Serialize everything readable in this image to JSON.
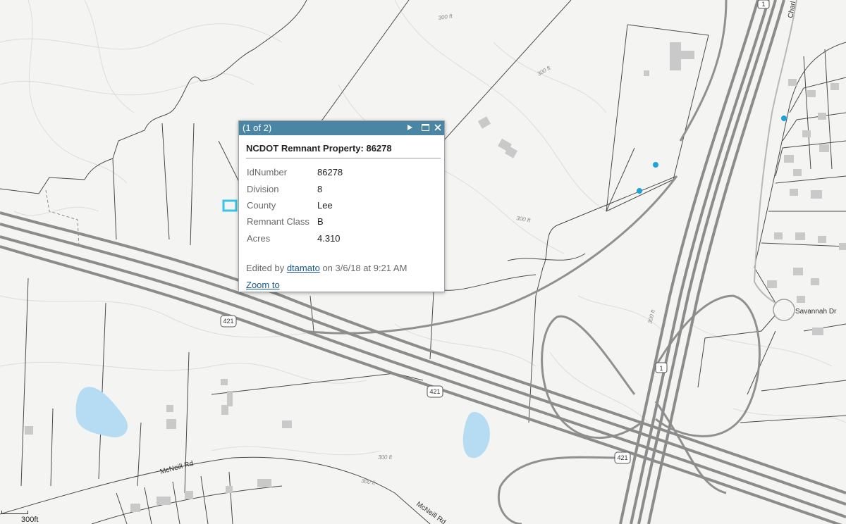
{
  "popup": {
    "count": "(1 of 2)",
    "title": "NCDOT Remnant Property: 86278",
    "fields": [
      {
        "label": "IdNumber",
        "value": "86278"
      },
      {
        "label": "Division",
        "value": "8"
      },
      {
        "label": "County",
        "value": "Lee"
      },
      {
        "label": "Remnant Class",
        "value": "B"
      },
      {
        "label": "Acres",
        "value": "4.310"
      }
    ],
    "edited_prefix": "Edited by",
    "edited_user": "dtamato",
    "edited_suffix": "on 3/6/18 at 9:21 AM",
    "zoom_label": "Zoom to"
  },
  "map": {
    "labels": {
      "road_mcneill_1": "McNeill Rd",
      "road_mcneill_2": "McNeill Rd",
      "road_savannah": "Savannah Dr",
      "road_charl": "Charl",
      "contour_1": "300 ft",
      "contour_2": "300 ft",
      "contour_3": "300 ft",
      "contour_4": "300 ft",
      "contour_5": "300 ft",
      "contour_6": "300 ft",
      "shield_421_1": "421",
      "shield_421_2": "421",
      "shield_421_3": "421",
      "shield_1_1": "1",
      "shield_1_2": "1"
    },
    "colors": {
      "background": "#f4f4f2",
      "highway": "#8c8c8c",
      "parcel": "#4a4a4a",
      "water": "#b5dcf2",
      "building": "#c9c9c9",
      "point": "#1ea2dc",
      "popup_header": "#4a86a4"
    }
  },
  "scalebar": {
    "label": "300ft"
  }
}
